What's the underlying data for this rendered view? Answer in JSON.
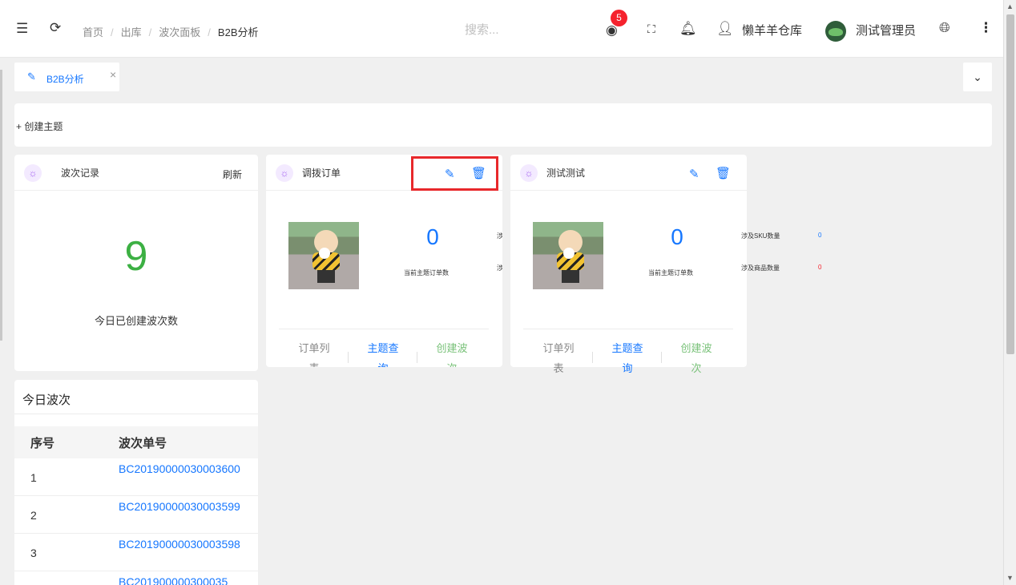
{
  "header": {
    "breadcrumb": [
      "首页",
      "出库",
      "波次面板",
      "B2B分析"
    ],
    "search_placeholder": "搜索...",
    "notification_count": "5",
    "warehouse": "懒羊羊仓库",
    "user": "测试管理员"
  },
  "tabs": [
    {
      "label": "B2B分析"
    }
  ],
  "create_topic": "+ 创建主题",
  "wave_record": {
    "title": "波次记录",
    "refresh": "刷新",
    "count": "9",
    "count_label": "今日已创建波次数"
  },
  "topic_cards": [
    {
      "title": "调拨订单",
      "order_count": "0",
      "order_count_label": "当前主题订单数",
      "side_labels": [
        "涉及",
        "涉及"
      ],
      "actions": [
        "订单列表",
        "主题查询",
        "创建波次"
      ]
    },
    {
      "title": "测试测试",
      "order_count": "0",
      "order_count_label": "当前主题订单数",
      "stats": [
        {
          "label": "涉及SKU数量",
          "value": "0",
          "color": "#1677ff"
        },
        {
          "label": "涉及商品数量",
          "value": "0",
          "color": "#f5222d"
        }
      ],
      "actions": [
        "订单列表",
        "主题查询",
        "创建波次"
      ]
    }
  ],
  "today_waves": {
    "title": "今日波次",
    "columns": [
      "序号",
      "波次单号"
    ],
    "rows": [
      {
        "index": "1",
        "code": "BC20190000030003600"
      },
      {
        "index": "2",
        "code": "BC20190000030003599"
      },
      {
        "index": "3",
        "code": "BC20190000030003598"
      },
      {
        "index": "",
        "code": "BC201900000300035"
      }
    ]
  },
  "colors": {
    "accent": "#1677ff",
    "success": "#3cb043",
    "danger": "#f5222d",
    "highlight": "#e8282b"
  },
  "icons": [
    "menu-fold-icon",
    "reload-icon",
    "target-icon",
    "fullscreen-icon",
    "bell-icon",
    "user-icon",
    "globe-icon",
    "more-icon",
    "edit-icon",
    "delete-icon",
    "bulb-icon",
    "close-icon",
    "chevron-down-icon"
  ]
}
